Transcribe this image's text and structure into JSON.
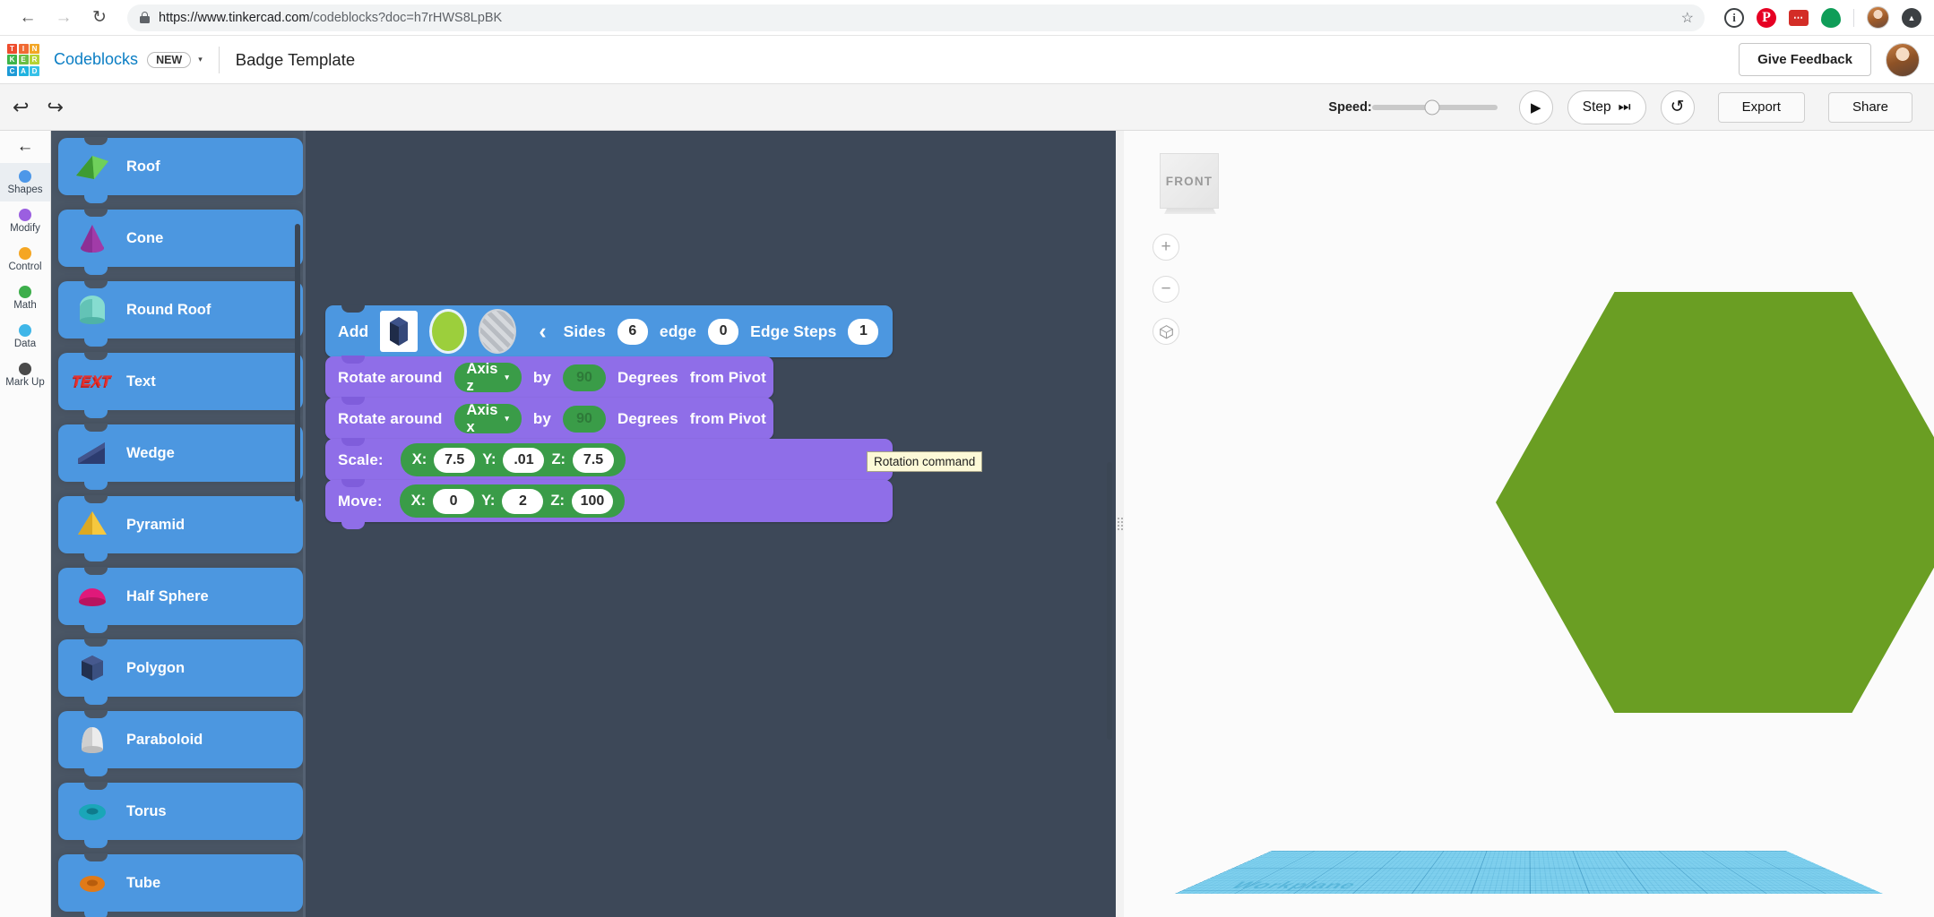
{
  "browser": {
    "back_icon": "←",
    "forward_icon": "→",
    "reload_icon": "↻",
    "lock_icon": "lock-icon",
    "url_prefix": "https://www.tinkercad.com",
    "url_path": "/codeblocks?doc=h7rHWS8LpBK",
    "star_icon": "☆",
    "extensions": [
      {
        "name": "info-extension-icon",
        "glyph": "i"
      },
      {
        "name": "pinterest-extension-icon",
        "glyph": "P"
      },
      {
        "name": "lastpass-extension-icon",
        "glyph": "•••"
      },
      {
        "name": "onepassword-extension-icon",
        "glyph": ""
      },
      {
        "name": "profile-avatar",
        "glyph": ""
      },
      {
        "name": "upload-extension-icon",
        "glyph": ""
      }
    ]
  },
  "header": {
    "logo_cells": [
      {
        "letter": "T",
        "color": "#ee4d2e"
      },
      {
        "letter": "I",
        "color": "#f06a33"
      },
      {
        "letter": "N",
        "color": "#f3a625"
      },
      {
        "letter": "K",
        "color": "#3db54a"
      },
      {
        "letter": "E",
        "color": "#6bbe45"
      },
      {
        "letter": "R",
        "color": "#b6d334"
      },
      {
        "letter": "C",
        "color": "#1e9ad6"
      },
      {
        "letter": "A",
        "color": "#1fb3e0"
      },
      {
        "letter": "D",
        "color": "#35c1e8"
      }
    ],
    "brand": "Codeblocks",
    "new_badge": "NEW",
    "caret_icon": "▾",
    "doc_title": "Badge Template",
    "feedback_label": "Give Feedback",
    "avatar_name": "user-avatar"
  },
  "toolbar": {
    "undo_icon": "↩",
    "redo_icon": "↪",
    "speed_label": "Speed:",
    "speed_value": 48,
    "play_icon": "▶",
    "step_label": "Step",
    "step_icon": "⏭",
    "reset_icon": "↺",
    "export_label": "Export",
    "share_label": "Share"
  },
  "rail": {
    "back_icon": "←",
    "items": [
      {
        "label": "Shapes",
        "color": "#4d97e8",
        "active": true
      },
      {
        "label": "Modify",
        "color": "#9b5fe0",
        "active": false
      },
      {
        "label": "Control",
        "color": "#f5a623",
        "active": false
      },
      {
        "label": "Math",
        "color": "#3dae4b",
        "active": false
      },
      {
        "label": "Data",
        "color": "#3fb6e8",
        "active": false
      },
      {
        "label": "Mark Up",
        "color": "#4a4a4a",
        "active": false
      }
    ]
  },
  "palette": {
    "shapes": [
      {
        "label": "Roof",
        "icon": "roof-shape-icon"
      },
      {
        "label": "Cone",
        "icon": "cone-shape-icon"
      },
      {
        "label": "Round Roof",
        "icon": "round-roof-shape-icon"
      },
      {
        "label": "Text",
        "icon": "text-shape-icon"
      },
      {
        "label": "Wedge",
        "icon": "wedge-shape-icon"
      },
      {
        "label": "Pyramid",
        "icon": "pyramid-shape-icon"
      },
      {
        "label": "Half Sphere",
        "icon": "half-sphere-shape-icon"
      },
      {
        "label": "Polygon",
        "icon": "polygon-shape-icon"
      },
      {
        "label": "Paraboloid",
        "icon": "paraboloid-shape-icon"
      },
      {
        "label": "Torus",
        "icon": "torus-shape-icon"
      },
      {
        "label": "Tube",
        "icon": "tube-shape-icon"
      }
    ]
  },
  "code": {
    "add_block": {
      "label": "Add",
      "shape_swatch": "polygon-solid-icon",
      "solid_toggle": "solid-ellipse-icon",
      "hole_toggle": "hole-ellipse-icon",
      "collapse_icon": "‹",
      "sides_label": "Sides",
      "sides_value": "6",
      "edge_label": "edge",
      "edge_value": "0",
      "edge_steps_label": "Edge Steps",
      "edge_steps_value": "1"
    },
    "rotate_blocks": [
      {
        "label": "Rotate around",
        "axis": "Axis z",
        "by_label": "by",
        "degrees_value": "90",
        "degrees_label": "Degrees",
        "pivot_label": "from Pivot"
      },
      {
        "label": "Rotate around",
        "axis": "Axis x",
        "by_label": "by",
        "degrees_value": "90",
        "degrees_label": "Degrees",
        "pivot_label": "from Pivot"
      }
    ],
    "scale_block": {
      "label": "Scale:",
      "x_label": "X:",
      "x_value": "7.5",
      "y_label": "Y:",
      "y_value": ".01",
      "z_label": "Z:",
      "z_value": "7.5"
    },
    "move_block": {
      "label": "Move:",
      "x_label": "X:",
      "x_value": "0",
      "y_label": "Y:",
      "y_value": "2",
      "z_label": "Z:",
      "z_value": "100"
    },
    "tooltip": "Rotation command"
  },
  "viewport": {
    "view_cube_label": "FRONT",
    "zoom_in_icon": "+",
    "zoom_out_icon": "−",
    "fit_icon": "⬡",
    "workplane_label": "Workplane",
    "object_color": "#6a9e23",
    "workplane_color": "#7fd0ee"
  }
}
